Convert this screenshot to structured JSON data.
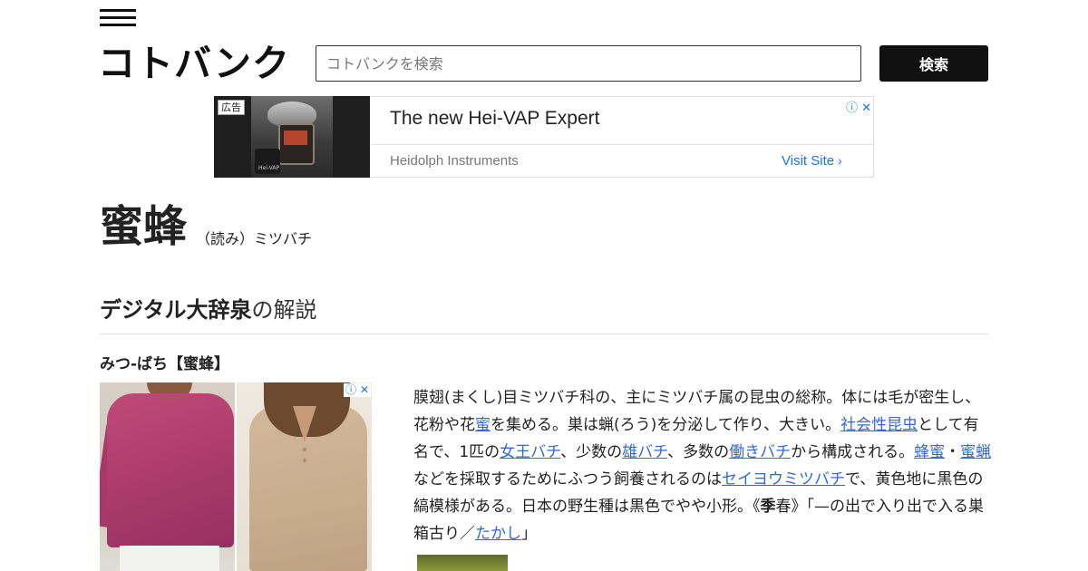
{
  "header": {
    "logo": "コトバンク",
    "menu_icon": "hamburger-menu-icon",
    "search_placeholder": "コトバンクを検索",
    "search_button": "検索"
  },
  "ad_banner": {
    "tag": "広告",
    "title": "The new Hei-VAP Expert",
    "advertiser": "Heidolph Instruments",
    "cta": "Visit Site",
    "choices_icon": "ⓘ",
    "close_icon": "✕",
    "product_brand": "Hei-VAP"
  },
  "entry": {
    "word": "蜜蜂",
    "reading": "（読み）ミツバチ"
  },
  "dictionary": {
    "name": "デジタル大辞泉",
    "suffix": "の解説",
    "headline": "みつ‐ばち【蜜蜂】",
    "body": {
      "t1": "膜翅(まくし)目ミツバチ科の、主にミツバチ属の昆虫の総称。体には毛が密生し、花粉や花",
      "l1": "蜜",
      "t2": "を集める。巣は蝋(ろう)を分泌して作り、大きい。",
      "l2": "社会性昆虫",
      "t3": "として有名で、1匹の",
      "l3": "女王バチ",
      "t4": "、少数の",
      "l4": "雄バチ",
      "t5": "、多数の",
      "l5": "働きバチ",
      "t6": "から構成される。",
      "l6": "蜂蜜",
      "t7": "・",
      "l7": "蜜蝋",
      "t8": "などを採取するためにふつう飼養されるのは",
      "l8": "セイヨウミツバチ",
      "t9": "で、黄色地に黒色の縞模様がある。日本の野生種は黒色でやや小形。《",
      "b1": "季",
      "t10": "春》「—の出で入り出で入る巣箱古り／",
      "l9": "たかし",
      "t11": "」"
    }
  },
  "product_ad": {
    "choices_icon": "ⓘ",
    "close_icon": "✕"
  }
}
